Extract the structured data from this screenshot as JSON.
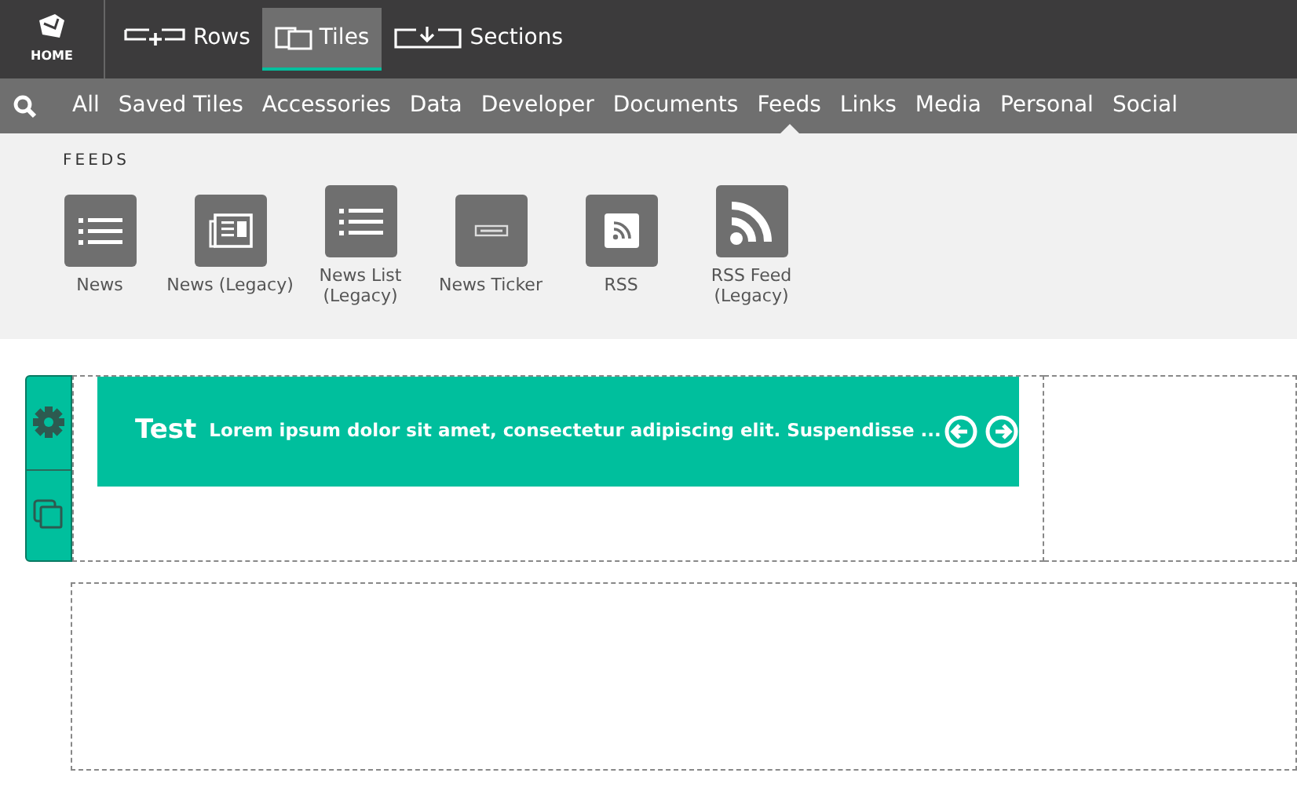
{
  "home": {
    "label": "HOME"
  },
  "modes": [
    {
      "label": "Rows",
      "kind": "rows",
      "selected": false
    },
    {
      "label": "Tiles",
      "kind": "tiles",
      "selected": true
    },
    {
      "label": "Sections",
      "kind": "sections",
      "selected": false
    }
  ],
  "categories": [
    {
      "label": "All",
      "selected": false
    },
    {
      "label": "Saved Tiles",
      "selected": false
    },
    {
      "label": "Accessories",
      "selected": false
    },
    {
      "label": "Data",
      "selected": false
    },
    {
      "label": "Developer",
      "selected": false
    },
    {
      "label": "Documents",
      "selected": false
    },
    {
      "label": "Feeds",
      "selected": true
    },
    {
      "label": "Links",
      "selected": false
    },
    {
      "label": "Media",
      "selected": false
    },
    {
      "label": "Personal",
      "selected": false
    },
    {
      "label": "Social",
      "selected": false
    }
  ],
  "panel": {
    "heading": "FEEDS",
    "tiles": [
      {
        "label": "News",
        "kind": "list"
      },
      {
        "label": "News (Legacy)",
        "kind": "newspaper"
      },
      {
        "label": "News List (Legacy)",
        "kind": "list"
      },
      {
        "label": "News Ticker",
        "kind": "ticker"
      },
      {
        "label": "RSS",
        "kind": "rss-box"
      },
      {
        "label": "RSS Feed (Legacy)",
        "kind": "rss"
      }
    ]
  },
  "ticker": {
    "title": "Test",
    "text": "Lorem ipsum dolor sit amet, consectetur adipiscing elit. Suspendisse ..."
  }
}
